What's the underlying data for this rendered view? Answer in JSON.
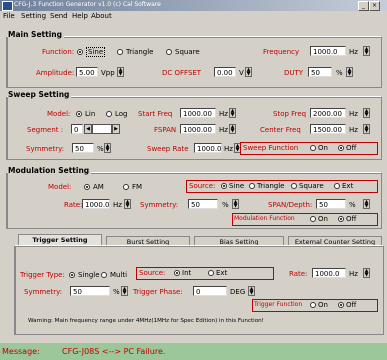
{
  "window": {
    "title": "CFG-J.3 Function Generator v1.0  (c)  Cal Software"
  },
  "menu": [
    "File",
    "Setting",
    "Send",
    "Help",
    "About"
  ],
  "main_setting": {
    "title": "Main Setting",
    "function_label": "Function:",
    "function_options": [
      "Sine",
      "Triangle",
      "Square"
    ],
    "function_selected": "Sine",
    "amplitude_label": "Amplitude:",
    "amplitude_value": "5.00",
    "amplitude_unit": "Vpp",
    "dc_offset_label": "DC OFFSET",
    "dc_offset_value": "0.00",
    "dc_offset_unit": "V",
    "frequency_label": "Frequency",
    "frequency_value": "1000.0",
    "frequency_unit": "Hz",
    "duty_label": "DUTY",
    "duty_value": "50",
    "duty_unit": "%"
  },
  "sweep_setting": {
    "title": "Sweep Setting",
    "model_label": "Model:",
    "model_options": [
      "Lin",
      "Log"
    ],
    "model_selected": "Lin",
    "segment_label": "Segment :",
    "segment_value": "0",
    "symmetry_label": "Symmetry:",
    "symmetry_value": "50",
    "symmetry_unit": "%",
    "start_freq_label": "Start Freq",
    "start_freq_value": "1000.00",
    "start_freq_unit": "Hz",
    "fspan_label": "FSPAN",
    "fspan_value": "1000.00",
    "fspan_unit": "Hz",
    "sweep_rate_label": "Sweep Rate",
    "sweep_rate_value": "1000.0",
    "sweep_rate_unit": "Hz",
    "stop_freq_label": "Stop Freq",
    "stop_freq_value": "2000.00",
    "stop_freq_unit": "Hz",
    "center_freq_label": "Center Freq",
    "center_freq_value": "1500.00",
    "center_freq_unit": "Hz",
    "sweep_function_label": "Sweep Function",
    "onoff_options": [
      "On",
      "Off"
    ],
    "sweep_function_selected": "Off"
  },
  "modulation_setting": {
    "title": "Modulation Setting",
    "model_label": "Model:",
    "model_options": [
      "AM",
      "FM"
    ],
    "model_selected": "AM",
    "rate_label": "Rate:",
    "rate_value": "1000.0",
    "rate_unit": "Hz",
    "symmetry_label": "Symmetry:",
    "symmetry_value": "50",
    "symmetry_unit": "%",
    "source_label": "Source:",
    "source_options": [
      "Sine",
      "Triangle",
      "Square",
      "Ext"
    ],
    "source_selected": "Sine",
    "span_depth_label": "SPAN/Depth:",
    "span_depth_value": "50",
    "span_depth_unit": "%",
    "modulation_function_label": "Modulation Function",
    "onoff_options": [
      "On",
      "Off"
    ],
    "modulation_function_selected": "Off"
  },
  "tabs": [
    "Trigger Setting",
    "Burst Setting",
    "Bias Setting",
    "External Counter Setting"
  ],
  "trigger_setting": {
    "trigger_type_label": "Trigger Type:",
    "trigger_type_options": [
      "Single",
      "Multi"
    ],
    "trigger_type_selected": "Single",
    "source_label": "Source:",
    "source_options": [
      "Int",
      "Ext"
    ],
    "source_selected": "Int",
    "rate_label": "Rate:",
    "rate_value": "1000.0",
    "rate_unit": "Hz",
    "symmetry_label": "Symmetry:",
    "symmetry_value": "50",
    "symmetry_unit": "%",
    "trigger_phase_label": "Trigger Phase:",
    "trigger_phase_value": "0",
    "trigger_phase_unit": "DEG",
    "trigger_function_label": "Trigger Function",
    "onoff_options": [
      "On",
      "Off"
    ],
    "trigger_function_selected": "Off",
    "warning": "Warning: Main frequency range under 4MHz(1MHz for Spec Edition) in this Function!"
  },
  "status": {
    "label": "Message:",
    "text": "CFG-J08S <--> PC Failure."
  },
  "colors": {
    "accent": "#c00000",
    "status_bg": "#9cc79a",
    "titlebar": "#6e7f99"
  }
}
